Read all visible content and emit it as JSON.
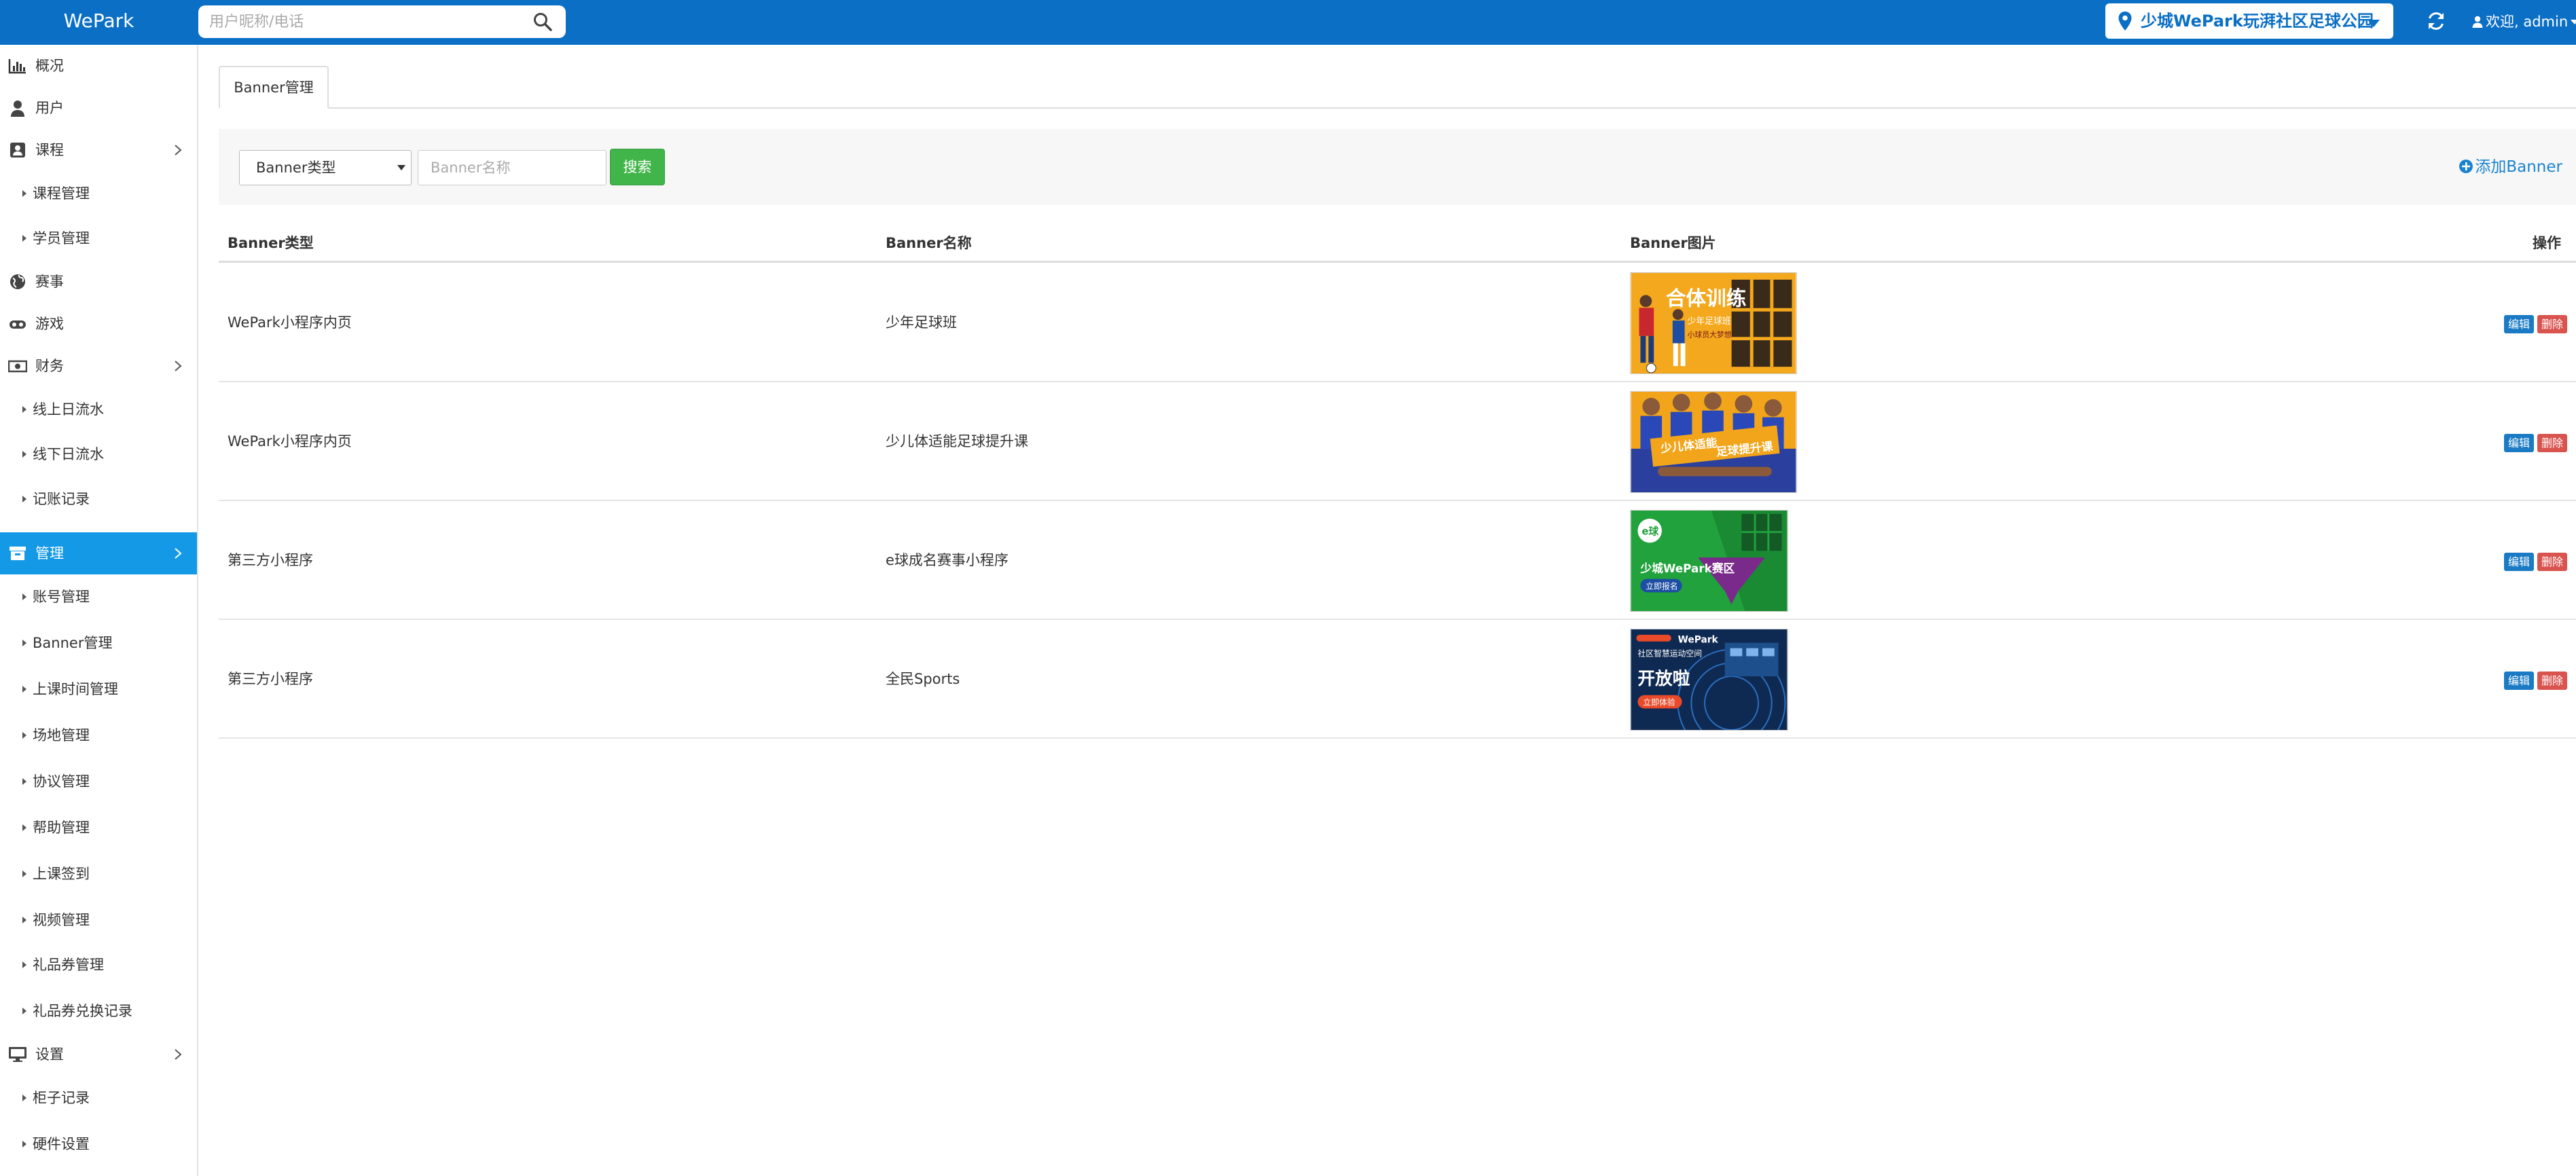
{
  "app": {
    "brand": "WePark"
  },
  "topbar": {
    "search_placeholder": "用户昵称/电话",
    "venue": "少城WePark玩湃社区足球公园",
    "welcome": "欢迎, admin"
  },
  "sidebar": {
    "items": [
      {
        "label": "概况",
        "icon": "bar-chart-icon"
      },
      {
        "label": "用户",
        "icon": "user-icon"
      },
      {
        "label": "课程",
        "icon": "contact-card-icon"
      },
      {
        "label": "课程管理"
      },
      {
        "label": "学员管理"
      },
      {
        "label": "赛事",
        "icon": "globe-icon"
      },
      {
        "label": "游戏",
        "icon": "gamepad-icon"
      },
      {
        "label": "财务",
        "icon": "money-icon"
      },
      {
        "label": "线上日流水"
      },
      {
        "label": "线下日流水"
      },
      {
        "label": "记账记录"
      },
      {
        "label": "管理",
        "icon": "archive-icon"
      },
      {
        "label": "账号管理"
      },
      {
        "label": "Banner管理"
      },
      {
        "label": "上课时间管理"
      },
      {
        "label": "场地管理"
      },
      {
        "label": "协议管理"
      },
      {
        "label": "帮助管理"
      },
      {
        "label": "上课签到"
      },
      {
        "label": "视频管理"
      },
      {
        "label": "礼品券管理"
      },
      {
        "label": "礼品券兑换记录"
      },
      {
        "label": "设置",
        "icon": "desktop-icon"
      },
      {
        "label": "柜子记录"
      },
      {
        "label": "硬件设置"
      }
    ]
  },
  "main": {
    "tab": "Banner管理",
    "filter": {
      "type_select": "Banner类型",
      "name_placeholder": "Banner名称",
      "search_button": "搜索",
      "add_button": "添加Banner"
    },
    "table": {
      "headers": [
        "Banner类型",
        "Banner名称",
        "Banner图片",
        "操作"
      ],
      "rows": [
        {
          "type": "WePark小程序内页",
          "name": "少年足球班",
          "image_texts": [
            "合体训练",
            "少年足球班",
            "小球员大梦想"
          ]
        },
        {
          "type": "WePark小程序内页",
          "name": "少儿体适能足球提升课",
          "image_texts": [
            "少儿体适能",
            "足球提升课"
          ]
        },
        {
          "type": "第三方小程序",
          "name": "e球成名赛事小程序",
          "image_texts": [
            "e球",
            "少城WePark赛区",
            "立即报名"
          ]
        },
        {
          "type": "第三方小程序",
          "name": "全民Sports",
          "image_texts": [
            "WePark",
            "社区智慧运动空间",
            "开放啦",
            "立即体验"
          ]
        }
      ],
      "edit_label": "编辑",
      "delete_label": "删除"
    }
  },
  "colors": {
    "topbar": "#0a6fc5",
    "sidebar_active": "#1499e6",
    "search_button": "#42b54a",
    "edit_button": "#1a7bc4",
    "delete_button": "#d9534f"
  }
}
